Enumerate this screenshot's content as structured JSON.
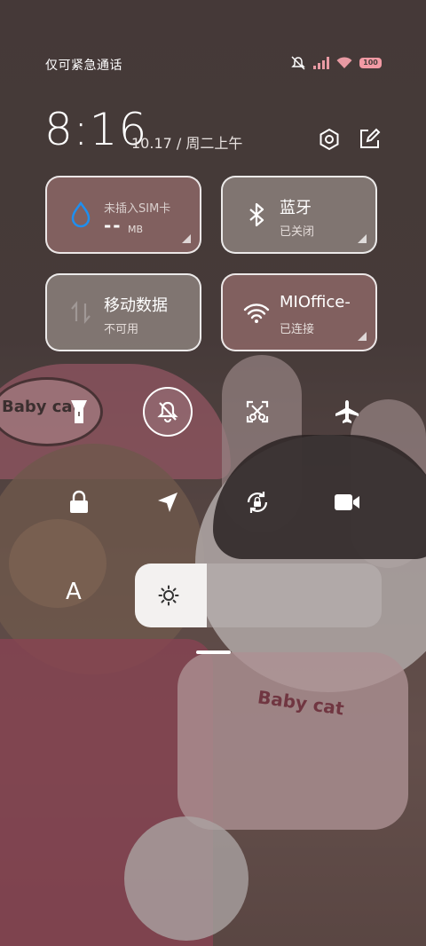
{
  "status_bar": {
    "carrier_text": "仅可紧急通话",
    "battery_level": "100",
    "icons": [
      "notifications-muted-icon",
      "signal-bars-icon",
      "wifi-icon",
      "battery-icon"
    ]
  },
  "header": {
    "time": "8:16",
    "date": "10.17 / 周二上午",
    "icons": [
      "settings-icon",
      "edit-icon"
    ]
  },
  "tiles": [
    {
      "id": "data-usage",
      "title": "未插入SIM卡",
      "value": "--",
      "unit": "MB",
      "icon": "water-drop-icon"
    },
    {
      "id": "bluetooth",
      "title": "蓝牙",
      "sub": "已关闭",
      "icon": "bluetooth-icon"
    },
    {
      "id": "mobile-data",
      "title": "移动数据",
      "sub": "不可用",
      "icon": "mobile-data-icon"
    },
    {
      "id": "wifi",
      "title": "MIOffice-",
      "sub": "已连接",
      "icon": "wifi-icon"
    }
  ],
  "toggles_row1": [
    "flashlight-icon",
    "mute-bell-icon",
    "screenshot-icon",
    "airplane-icon"
  ],
  "toggles_row2": [
    "lock-icon",
    "location-icon",
    "rotation-lock-icon",
    "video-camera-icon"
  ],
  "brightness": {
    "auto_label": "A",
    "level": 0.29
  },
  "wallpaper_text": {
    "hat": "Baby cat",
    "bib": "Baby cat"
  },
  "colors": {
    "tile_bg": "#8f7b78",
    "tile_bg_warm": "#8e6e6c",
    "accent_blue": "#1e8ff0",
    "battery": "#f29aa4"
  }
}
